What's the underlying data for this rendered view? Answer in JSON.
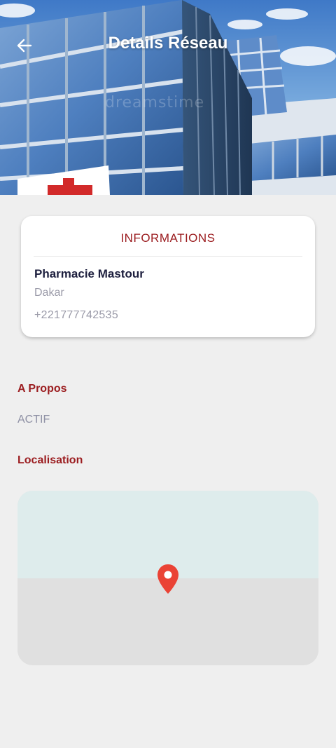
{
  "header": {
    "title": "Details Réseau",
    "back_icon": "arrow-left-icon",
    "watermark": "dreamstime",
    "colors": {
      "title": "#ffffff"
    }
  },
  "info_card": {
    "heading": "INFORMATIONS",
    "name": "Pharmacie Mastour",
    "city": "Dakar",
    "phone": "+221777742535"
  },
  "about": {
    "title": "A Propos",
    "value": "ACTIF"
  },
  "location": {
    "title": "Localisation",
    "marker_icon": "map-pin-icon"
  },
  "colors": {
    "accent": "#9b1c1f",
    "name_text": "#1d1f3e",
    "muted_text": "#9a9aa8",
    "background": "#efefef",
    "map_water": "#deecec",
    "map_land": "#e0e0e0",
    "pin": "#ea4335"
  }
}
